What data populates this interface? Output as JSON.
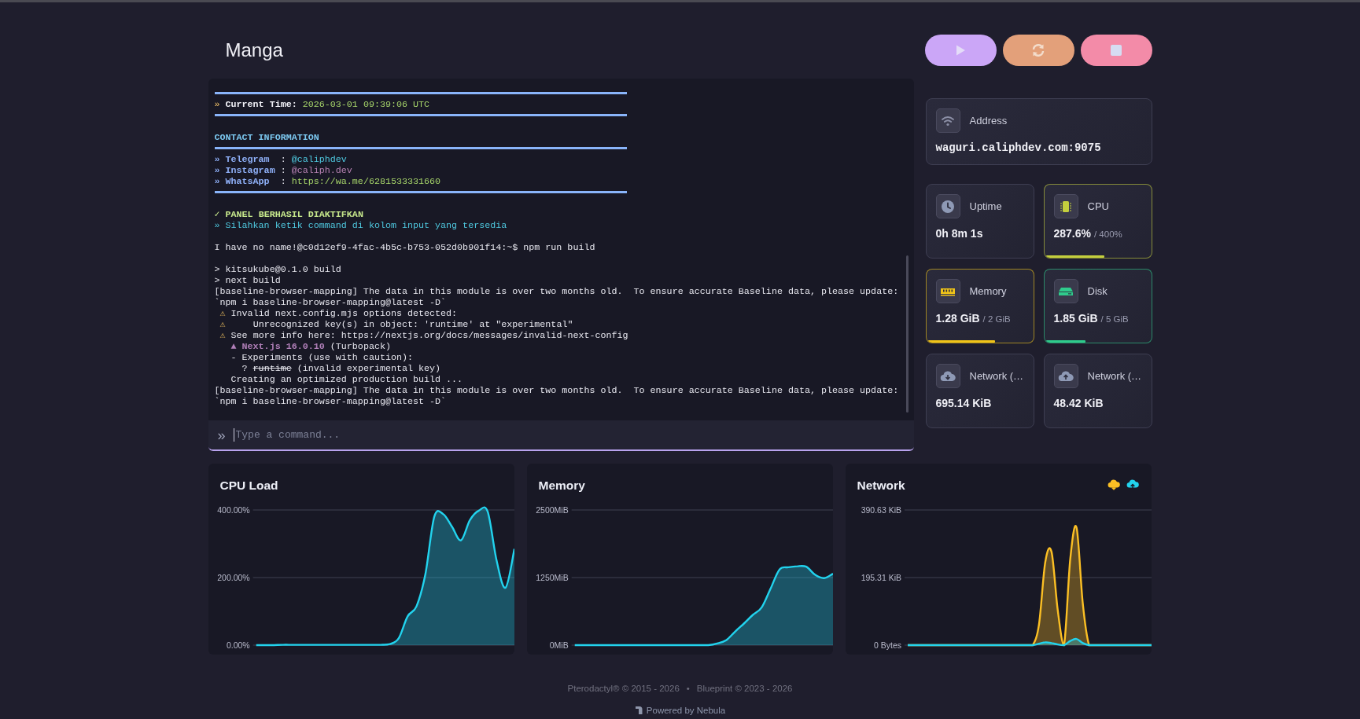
{
  "server": {
    "name": "Manga"
  },
  "terminal": {
    "lines": [
      {
        "kind": "rule"
      },
      {
        "kind": "text",
        "segments": [
          {
            "text": "» ",
            "kind": "accent"
          },
          {
            "text": "Current Time:",
            "kind": "bold"
          },
          {
            "text": " 2026-03-01 09:39:06 UTC",
            "kind": "green"
          }
        ]
      },
      {
        "kind": "rule"
      },
      {
        "kind": "blank"
      },
      {
        "kind": "text",
        "segments": [
          {
            "text": "CONTACT INFORMATION",
            "kind": "heading"
          }
        ]
      },
      {
        "kind": "rule"
      },
      {
        "kind": "text",
        "segments": [
          {
            "text": "» Telegram  ",
            "kind": "key"
          },
          {
            "text": ": ",
            "kind": "plain"
          },
          {
            "text": "@caliphdev",
            "kind": "cyan"
          }
        ]
      },
      {
        "kind": "text",
        "segments": [
          {
            "text": "» Instagram ",
            "kind": "key"
          },
          {
            "text": ": ",
            "kind": "plain"
          },
          {
            "text": "@caliph.dev",
            "kind": "mauve"
          }
        ]
      },
      {
        "kind": "text",
        "segments": [
          {
            "text": "» WhatsApp  ",
            "kind": "key"
          },
          {
            "text": ": ",
            "kind": "plain"
          },
          {
            "text": "https://wa.me/6281533331660",
            "kind": "green"
          }
        ]
      },
      {
        "kind": "rule"
      },
      {
        "kind": "blank"
      },
      {
        "kind": "text",
        "segments": [
          {
            "text": "✓ PANEL BERHASIL DIAKTIFKAN",
            "kind": "success"
          }
        ]
      },
      {
        "kind": "text",
        "segments": [
          {
            "text": "» Silahkan ketik command di kolom input yang tersedia",
            "kind": "info"
          }
        ]
      },
      {
        "kind": "blank"
      },
      {
        "kind": "text",
        "segments": [
          {
            "text": "I have no name!@c0d12ef9-4fac-4b5c-b753-052d0b901f14:~$ npm run build",
            "kind": "plain"
          }
        ]
      },
      {
        "kind": "blank"
      },
      {
        "kind": "text",
        "segments": [
          {
            "text": "> kitsukube@0.1.0 build",
            "kind": "plain"
          }
        ]
      },
      {
        "kind": "text",
        "segments": [
          {
            "text": "> next build",
            "kind": "plain"
          }
        ]
      },
      {
        "kind": "text",
        "segments": [
          {
            "text": "[baseline-browser-mapping] The data in this module is over two months old.  To ensure accurate Baseline data, please update:",
            "kind": "plain"
          }
        ]
      },
      {
        "kind": "text",
        "segments": [
          {
            "text": "`npm i baseline-browser-mapping@latest -D`",
            "kind": "plain"
          }
        ]
      },
      {
        "kind": "text",
        "segments": [
          {
            "text": " ⚠",
            "kind": "warn"
          },
          {
            "text": " Invalid next.config.mjs options detected:",
            "kind": "plain"
          }
        ]
      },
      {
        "kind": "text",
        "segments": [
          {
            "text": " ⚠",
            "kind": "warn"
          },
          {
            "text": "     Unrecognized key(s) in object: 'runtime' at \"experimental\"",
            "kind": "plain"
          }
        ]
      },
      {
        "kind": "text",
        "segments": [
          {
            "text": " ⚠",
            "kind": "warn"
          },
          {
            "text": " See more info here: https://nextjs.org/docs/messages/invalid-next-config",
            "kind": "plain"
          }
        ]
      },
      {
        "kind": "text",
        "segments": [
          {
            "text": "   ▲ Next.js 16.0.10",
            "kind": "next"
          },
          {
            "text": " (Turbopack)",
            "kind": "plain"
          }
        ]
      },
      {
        "kind": "text",
        "segments": [
          {
            "text": "   - Experiments (use with caution):",
            "kind": "plain"
          }
        ]
      },
      {
        "kind": "text",
        "segments": [
          {
            "text": "     ? ",
            "kind": "plain"
          },
          {
            "text": "runtime",
            "kind": "strike"
          },
          {
            "text": " (invalid experimental key)",
            "kind": "plain"
          }
        ]
      },
      {
        "kind": "text",
        "segments": [
          {
            "text": "   Creating an optimized production build ...",
            "kind": "plain"
          }
        ]
      },
      {
        "kind": "text",
        "segments": [
          {
            "text": "[baseline-browser-mapping] The data in this module is over two months old.  To ensure accurate Baseline data, please update:",
            "kind": "plain"
          }
        ]
      },
      {
        "kind": "text",
        "segments": [
          {
            "text": "`npm i baseline-browser-mapping@latest -D`",
            "kind": "plain"
          }
        ]
      }
    ],
    "prompt": "»",
    "placeholder": "Type a command..."
  },
  "address": {
    "label": "Address",
    "value": "waguri.caliphdev.com:9075"
  },
  "stats": [
    {
      "label": "Uptime",
      "value": "0h 8m 1s"
    },
    {
      "label": "CPU",
      "value": "287.6%",
      "limit": "/ 400%",
      "level": 0.55,
      "color": "#c4cf3d"
    },
    {
      "label": "Memory",
      "value": "1.28 GiB",
      "limit": "/ 2 GiB",
      "level": 0.63,
      "color": "#f0c419"
    },
    {
      "label": "Disk",
      "value": "1.85 GiB",
      "limit": "/ 5 GiB",
      "level": 0.37,
      "color": "#2fcb8c"
    },
    {
      "label": "Network (…",
      "value": "695.14 KiB"
    },
    {
      "label": "Network (…",
      "value": "48.42 KiB"
    }
  ],
  "charts": [
    {
      "title": "CPU Load",
      "chart_data": {
        "type": "area",
        "ylim": [
          0,
          400
        ],
        "yticks": [
          {
            "value": 0,
            "label": "0.00%"
          },
          {
            "value": 200,
            "label": "200.00%"
          },
          {
            "value": 400,
            "label": "400.00%"
          }
        ],
        "series": [
          {
            "color": "#22d3ee",
            "values": [
              0,
              0,
              0,
              1,
              1,
              1,
              1,
              1,
              1,
              1,
              1,
              1,
              1,
              1,
              1,
              3,
              20,
              85,
              115,
              210,
              380,
              388,
              350,
              310,
              370,
              398,
              395,
              250,
              170,
              285
            ]
          }
        ]
      }
    },
    {
      "title": "Memory",
      "chart_data": {
        "type": "area",
        "ylim": [
          0,
          2500
        ],
        "yticks": [
          {
            "value": 0,
            "label": "0MiB"
          },
          {
            "value": 1250,
            "label": "1250MiB"
          },
          {
            "value": 2500,
            "label": "2500MiB"
          }
        ],
        "series": [
          {
            "color": "#22d3ee",
            "values": [
              0,
              0,
              0,
              0,
              0,
              0,
              0,
              0,
              0,
              0,
              0,
              0,
              0,
              0,
              0,
              0,
              30,
              90,
              250,
              400,
              560,
              700,
              1050,
              1400,
              1440,
              1460,
              1450,
              1300,
              1240,
              1320
            ]
          }
        ]
      }
    },
    {
      "title": "Network",
      "chart_data": {
        "type": "area",
        "ylim": [
          0,
          390.63
        ],
        "yticks": [
          {
            "value": 0,
            "label": "0 Bytes"
          },
          {
            "value": 195.31,
            "label": "195.31 KiB"
          },
          {
            "value": 390.63,
            "label": "390.63 KiB"
          }
        ],
        "series": [
          {
            "color": "#fbbf24",
            "values": [
              0,
              0,
              0,
              0,
              0,
              0,
              0,
              0,
              0,
              0,
              0,
              0,
              0,
              0,
              0,
              0,
              0,
              0,
              0,
              0,
              0,
              60,
              240,
              270,
              100,
              0,
              250,
              340,
              120,
              0,
              0,
              0,
              0,
              0,
              0,
              0,
              0,
              0,
              0,
              0
            ]
          },
          {
            "color": "#22d3ee",
            "values": [
              0,
              0,
              0,
              0,
              0,
              0,
              0,
              0,
              0,
              0,
              0,
              0,
              0,
              0,
              0,
              0,
              0,
              0,
              0,
              0,
              0,
              4,
              8,
              6,
              2,
              0,
              12,
              18,
              6,
              0,
              0,
              0,
              0,
              0,
              0,
              0,
              0,
              0,
              0,
              0
            ]
          }
        ]
      }
    }
  ],
  "footer": {
    "credits": [
      "Pterodactyl® © 2015 - 2026",
      "•",
      "Blueprint © 2023 - 2026"
    ],
    "powered": "Powered by Nebula"
  }
}
